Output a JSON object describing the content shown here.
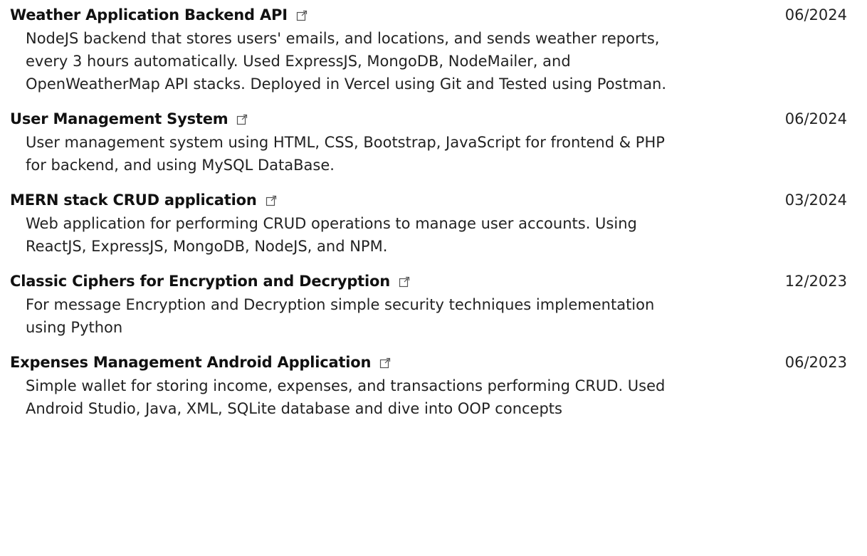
{
  "projects": [
    {
      "title": "Weather Application Backend API",
      "date": "06/2024",
      "description": "NodeJS backend that stores users' emails, and locations, and sends weather reports, every 3 hours automatically. Used ExpressJS, MongoDB, NodeMailer, and OpenWeatherMap API stacks. Deployed in Vercel using Git and Tested using Postman.",
      "icon": "external-link-icon"
    },
    {
      "title": "User Management System",
      "date": "06/2024",
      "description": "User management system using HTML, CSS, Bootstrap, JavaScript for frontend & PHP for backend, and using MySQL DataBase.",
      "icon": "external-link-icon"
    },
    {
      "title": "MERN stack CRUD application",
      "date": "03/2024",
      "description": "Web application for performing CRUD operations to manage user accounts. Using ReactJS, ExpressJS, MongoDB, NodeJS, and NPM.",
      "icon": "external-link-icon"
    },
    {
      "title": "Classic Ciphers for Encryption and Decryption",
      "date": "12/2023",
      "description": "For message Encryption and Decryption simple security techniques implementation using Python",
      "icon": "external-link-icon"
    },
    {
      "title": "Expenses Management Android Application",
      "date": "06/2023",
      "description": "Simple wallet for storing income, expenses, and transactions performing CRUD. Used Android Studio, Java, XML, SQLite database and dive into OOP concepts",
      "icon": "external-link-icon"
    }
  ]
}
